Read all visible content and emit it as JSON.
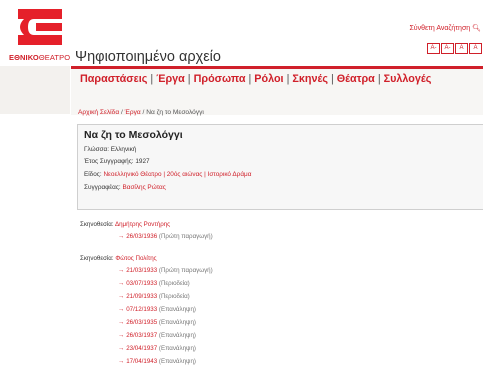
{
  "header": {
    "logo_text_bold": "ΕΘΝΙΚΟ",
    "logo_text_thin": "ΘΕΑΤΡΟ",
    "site_title": "Ψηφιοποιημένο αρχείο",
    "advanced_search": "Σύνθετη Αναζήτηση",
    "font_controls": [
      "A-",
      "A-",
      "A",
      "A"
    ]
  },
  "nav": {
    "items": [
      "Παραστάσεις",
      "Έργα",
      "Πρόσωπα",
      "Ρόλοι",
      "Σκηνές",
      "Θέατρα",
      "Συλλογές"
    ]
  },
  "breadcrumb": {
    "home": "Αρχική Σελίδα",
    "section": "Έργα",
    "current": "Να ζη το Μεσολόγγι"
  },
  "work": {
    "title": "Να ζη το Μεσολόγγι",
    "language_label": "Γλώσσα:",
    "language_value": "Ελληνική",
    "year_label": "Έτος Συγγραφής:",
    "year_value": "1927",
    "genre_label": "Είδος:",
    "genre_value": "Νεοελληνικό Θέατρο | 20ός αιώνας | Ιστορικό Δράμα",
    "author_label": "Συγγραφέας:",
    "author_value": "Βασίλης Ρώτας"
  },
  "productions": [
    {
      "label": "Σκηνοθεσία:",
      "director": "Δημήτρης Ροντήρης",
      "performances": [
        {
          "date": "26/03/1936",
          "note": "(Πρώτη παραγωγή)"
        }
      ]
    },
    {
      "label": "Σκηνοθεσία:",
      "director": "Φώτος Πολίτης",
      "performances": [
        {
          "date": "21/03/1933",
          "note": "(Πρώτη παραγωγή)"
        },
        {
          "date": "03/07/1933",
          "note": "(Περιοδεία)"
        },
        {
          "date": "21/09/1933",
          "note": "(Περιοδεία)"
        },
        {
          "date": "07/12/1933",
          "note": "(Επανάληψη)"
        },
        {
          "date": "26/03/1935",
          "note": "(Επανάληψη)"
        },
        {
          "date": "26/03/1937",
          "note": "(Επανάληψη)"
        },
        {
          "date": "23/04/1937",
          "note": "(Επανάληψη)"
        },
        {
          "date": "17/04/1943",
          "note": "(Επανάληψη)"
        }
      ]
    }
  ]
}
